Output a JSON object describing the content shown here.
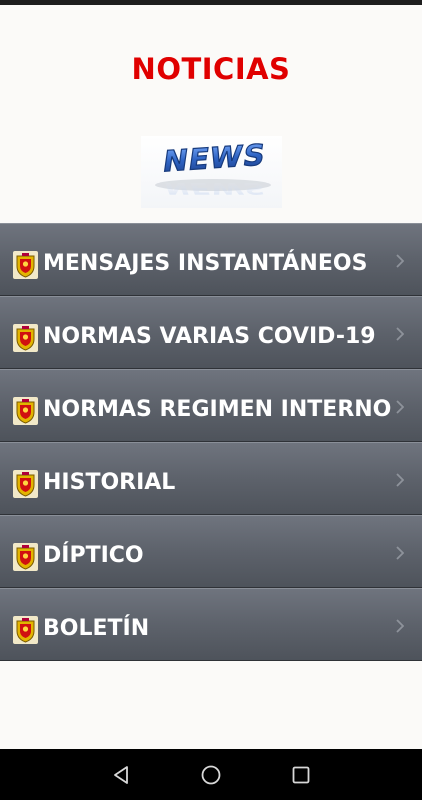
{
  "header": {
    "title": "NOTICIAS"
  },
  "logo": {
    "text": "NEWS"
  },
  "menu": {
    "items": [
      {
        "label": "MENSAJES INSTANTÁNEOS"
      },
      {
        "label": "NORMAS VARIAS COVID-19"
      },
      {
        "label": "NORMAS REGIMEN INTERNO"
      },
      {
        "label": "HISTORIAL"
      },
      {
        "label": "DÍPTICO"
      },
      {
        "label": "BOLETÍN"
      }
    ]
  },
  "icons": {
    "item_icon": "crest-icon",
    "item_arrow": "chevron-right-icon",
    "nav": [
      "back-icon",
      "home-icon",
      "recents-icon"
    ]
  },
  "colors": {
    "title": "#e00000",
    "menu_background": "#5d626b",
    "menu_text": "#ffffff",
    "news_logo": "#2f64c4"
  }
}
